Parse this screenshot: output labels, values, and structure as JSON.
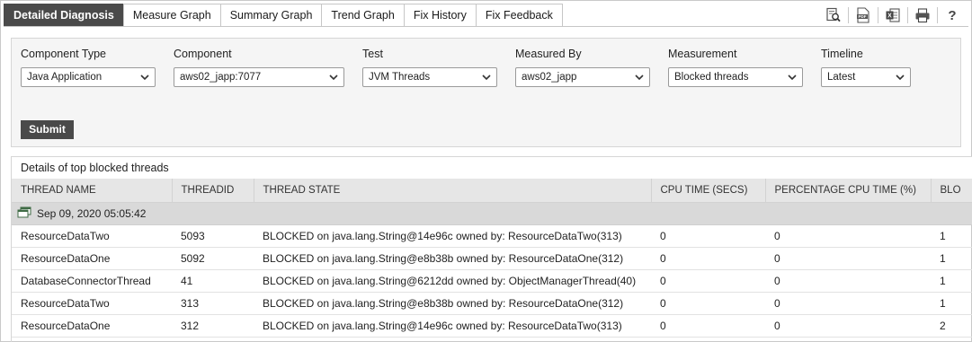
{
  "tabs": [
    {
      "label": "Detailed Diagnosis",
      "active": true
    },
    {
      "label": "Measure Graph"
    },
    {
      "label": "Summary Graph"
    },
    {
      "label": "Trend Graph"
    },
    {
      "label": "Fix History"
    },
    {
      "label": "Fix Feedback"
    }
  ],
  "toolbar": {
    "icons": [
      "search-report-icon",
      "pdf-icon",
      "excel-icon",
      "print-icon",
      "help-icon"
    ],
    "help_label": "?"
  },
  "filters": {
    "component_type": {
      "label": "Component Type",
      "value": "Java Application"
    },
    "component": {
      "label": "Component",
      "value": "aws02_japp:7077"
    },
    "test": {
      "label": "Test",
      "value": "JVM Threads"
    },
    "measured_by": {
      "label": "Measured By",
      "value": "aws02_japp"
    },
    "measurement": {
      "label": "Measurement",
      "value": "Blocked threads"
    },
    "timeline": {
      "label": "Timeline",
      "value": "Latest"
    },
    "submit_label": "Submit"
  },
  "results": {
    "title": "Details of top blocked threads",
    "columns": [
      "THREAD NAME",
      "THREADID",
      "THREAD STATE",
      "CPU TIME (SECS)",
      "PERCENTAGE CPU TIME (%)",
      "BLO"
    ],
    "group_label": "Sep 09, 2020 05:05:42",
    "rows": [
      [
        "ResourceDataTwo",
        "5093",
        "BLOCKED on java.lang.String@14e96c owned by: ResourceDataTwo(313)",
        "0",
        "0",
        "1"
      ],
      [
        "ResourceDataOne",
        "5092",
        "BLOCKED on java.lang.String@e8b38b owned by: ResourceDataOne(312)",
        "0",
        "0",
        "1"
      ],
      [
        "DatabaseConnectorThread",
        "41",
        "BLOCKED on java.lang.String@6212dd owned by: ObjectManagerThread(40)",
        "0",
        "0",
        "1"
      ],
      [
        "ResourceDataTwo",
        "313",
        "BLOCKED on java.lang.String@e8b38b owned by: ResourceDataOne(312)",
        "0",
        "0",
        "1"
      ],
      [
        "ResourceDataOne",
        "312",
        "BLOCKED on java.lang.String@14e96c owned by: ResourceDataTwo(313)",
        "0",
        "0",
        "2"
      ]
    ]
  },
  "colors": {
    "tab_active_bg": "#4a4a4a",
    "header_bg": "#e6e6e6",
    "group_bg": "#d9d9d9",
    "panel_bg": "#f5f5f5"
  }
}
